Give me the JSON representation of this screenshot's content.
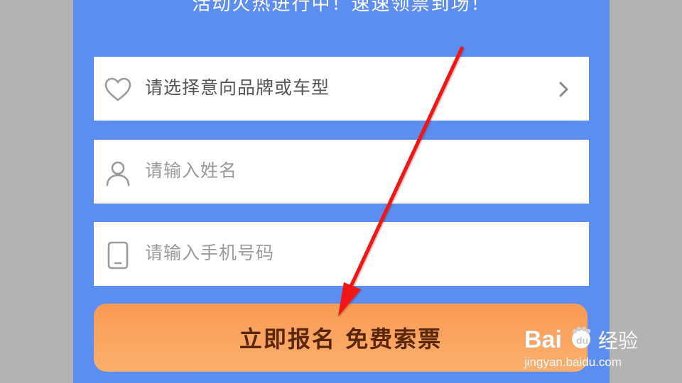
{
  "headline": "活动火热进行中！速速领票到场！",
  "form": {
    "brand_select": {
      "label": "请选择意向品牌或车型",
      "icon": "heart-icon"
    },
    "name_field": {
      "placeholder": "请输入姓名",
      "icon": "user-icon"
    },
    "phone_field": {
      "placeholder": "请输入手机号码",
      "icon": "phone-icon"
    },
    "submit_label": "立即报名 免费索票"
  },
  "watermark": {
    "brand": "Baidu经验",
    "url": "jingyan.baidu.com"
  },
  "colors": {
    "panel": "#5b8ef0",
    "button": "#f99a55",
    "arrow": "#f01818"
  }
}
